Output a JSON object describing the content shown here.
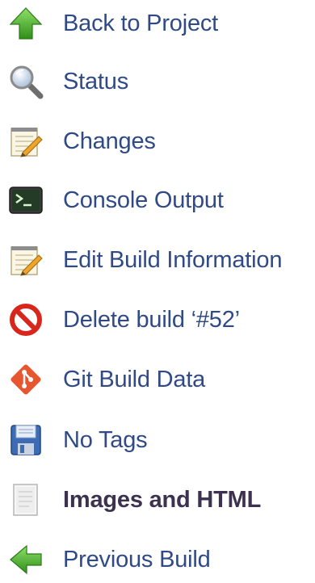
{
  "menu": {
    "items": [
      {
        "label": "Back to Project",
        "icon": "up-arrow-icon"
      },
      {
        "label": "Status",
        "icon": "search-icon"
      },
      {
        "label": "Changes",
        "icon": "notepad-icon"
      },
      {
        "label": "Console Output",
        "icon": "terminal-icon"
      },
      {
        "label": "Edit Build Information",
        "icon": "notepad-icon"
      },
      {
        "label": "Delete build ‘#52’",
        "icon": "no-entry-icon"
      },
      {
        "label": "Git Build Data",
        "icon": "git-icon"
      },
      {
        "label": "No Tags",
        "icon": "floppy-disk-icon"
      },
      {
        "label": "Images and HTML",
        "icon": "document-icon",
        "current": true
      },
      {
        "label": "Previous Build",
        "icon": "left-arrow-icon"
      }
    ]
  },
  "colors": {
    "link": "#2f4a86",
    "current": "#3c3250",
    "arrow_green": "#4caf2c",
    "delete_red": "#d9261c",
    "git_orange": "#e8562f"
  }
}
